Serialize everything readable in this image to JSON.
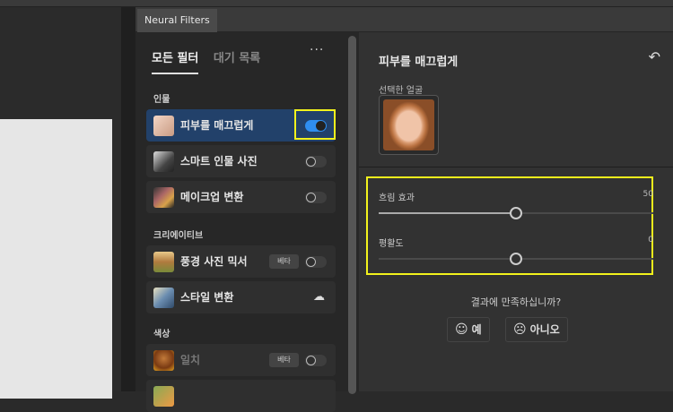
{
  "panel_tab": "Neural Filters",
  "filter_tabs": [
    {
      "label": "모든 필터",
      "active": true
    },
    {
      "label": "대기 목록",
      "active": false
    }
  ],
  "more_label": "···",
  "sections": {
    "portrait": "인물",
    "creative": "크리에이티브",
    "color": "색상"
  },
  "filters": [
    {
      "label": "피부를 매끄럽게",
      "enabled": true
    },
    {
      "label": "스마트 인물 사진",
      "enabled": false
    },
    {
      "label": "메이크업 변환",
      "enabled": false
    },
    {
      "label": "풍경 사진 믹서",
      "badge": "베타",
      "enabled": false
    },
    {
      "label": "스타일 변환",
      "icon": "cloud-download-icon"
    },
    {
      "label": "일치",
      "badge": "베타",
      "enabled": false
    }
  ],
  "detail": {
    "title": "피부를 매끄럽게",
    "selected_face_label": "선택한 얼굴",
    "sliders": [
      {
        "label": "흐림 효과",
        "value": "50",
        "min": 0,
        "max": 100,
        "fraction": 0.5
      },
      {
        "label": "평활도",
        "value": "0",
        "min": -50,
        "max": 50,
        "fraction": 0.5
      }
    ],
    "feedback_question": "결과에 만족하십니까?",
    "yes_label": "예",
    "no_label": "아니오"
  },
  "colors": {
    "accent": "#2f8ef0",
    "highlight": "#f2f21c",
    "selected_row": "#22416a"
  }
}
